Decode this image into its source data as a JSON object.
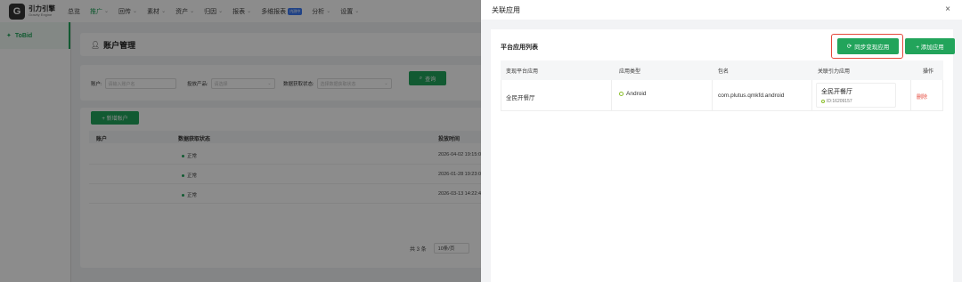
{
  "brand": {
    "mark": "G",
    "name_cn": "引力引擎",
    "name_en": "Gravity Engine"
  },
  "nav": [
    {
      "label": "总览",
      "chevron": false,
      "active": false
    },
    {
      "label": "推广",
      "chevron": true,
      "active": true
    },
    {
      "label": "回传",
      "chevron": true,
      "active": false
    },
    {
      "label": "素材",
      "chevron": true,
      "active": false
    },
    {
      "label": "资产",
      "chevron": true,
      "active": false
    },
    {
      "label": "归因",
      "chevron": true,
      "active": false
    },
    {
      "label": "报表",
      "chevron": true,
      "active": false
    },
    {
      "label": "多维报表",
      "chevron": false,
      "active": false,
      "badge": "内测中"
    },
    {
      "label": "分析",
      "chevron": true,
      "active": false
    },
    {
      "label": "设置",
      "chevron": true,
      "active": false
    }
  ],
  "sidebar": {
    "item": "ToBid"
  },
  "page": {
    "title": "账户管理"
  },
  "filters": {
    "account_label": "账户:",
    "account_placeholder": "请输入账户名",
    "product_label": "投放产品:",
    "product_placeholder": "请选择",
    "status_label": "数据获取状态:",
    "status_placeholder": "选择数据获取状态",
    "query_button": "查询"
  },
  "account_table": {
    "add_button": "+ 新增账户",
    "headers": {
      "account": "账户",
      "status": "数据获取状态",
      "time": "投放时间"
    },
    "rows": [
      {
        "status": "正常",
        "time": "2026-04-02 19:15:0"
      },
      {
        "status": "正常",
        "time": "2026-01-28 19:23:0"
      },
      {
        "status": "正常",
        "time": "2026-03-13 14:22:4"
      }
    ],
    "total": "共 3 条",
    "page_size": "10条/页"
  },
  "drawer": {
    "title": "关联应用",
    "close": "×",
    "list_title": "平台应用列表",
    "sync_button": "同步变现应用",
    "add_button": "+ 添加应用",
    "headers": {
      "platform_app": "变现平台应用",
      "app_type": "应用类型",
      "package": "包名",
      "linked_app": "关联引力应用",
      "action": "操作"
    },
    "rows": [
      {
        "platform_app": "全民开餐厅",
        "app_type": "Android",
        "package": "com.plutus.qmkfd.android",
        "linked_name": "全民开餐厅",
        "linked_id": "ID:16209157",
        "action": "删除"
      }
    ]
  },
  "colors": {
    "accent": "#22a45b",
    "highlight": "#e5483b",
    "danger": "#e5483b"
  }
}
